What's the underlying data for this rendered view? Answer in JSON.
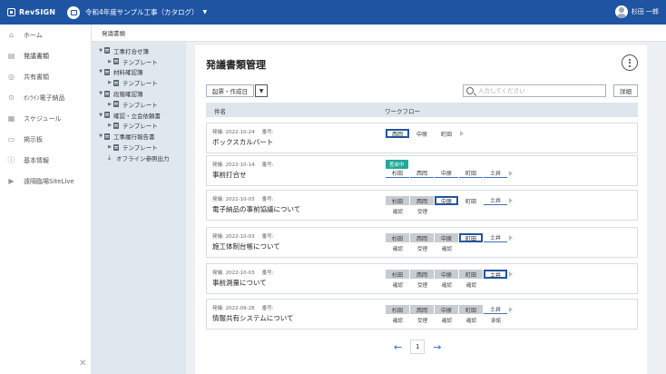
{
  "header": {
    "brand": "RevSIGN",
    "project_name": "令和4年度サンプル工事（カタログ）",
    "user_name": "杉田 一郎"
  },
  "nav": [
    {
      "label": "ホーム",
      "icon": "home-icon",
      "glyph": "⌂"
    },
    {
      "label": "発議書類",
      "icon": "document-icon",
      "glyph": "▤"
    },
    {
      "label": "共有書類",
      "icon": "share-icon",
      "glyph": "◎"
    },
    {
      "label": "ｵﾝﾗｲﾝ電子納品",
      "icon": "cloud-icon",
      "glyph": "⊙"
    },
    {
      "label": "スケジュール",
      "icon": "calendar-icon",
      "glyph": "▦"
    },
    {
      "label": "掲示板",
      "icon": "board-icon",
      "glyph": "▭"
    },
    {
      "label": "基本情報",
      "icon": "info-icon",
      "glyph": "ⓘ"
    },
    {
      "label": "遠隔臨場SiteLive",
      "icon": "video-icon",
      "glyph": "▶"
    }
  ],
  "breadcrumb": "発議書類",
  "tree": [
    {
      "label": "工事打合せ簿",
      "level": 0
    },
    {
      "label": "テンプレート",
      "level": 1
    },
    {
      "label": "材料確認簿",
      "level": 0
    },
    {
      "label": "テンプレート",
      "level": 1
    },
    {
      "label": "段階確認簿",
      "level": 0
    },
    {
      "label": "テンプレート",
      "level": 1
    },
    {
      "label": "確認・立会依頼書",
      "level": 0
    },
    {
      "label": "テンプレート",
      "level": 1
    },
    {
      "label": "工事履行報告書",
      "level": 0
    },
    {
      "label": "テンプレート",
      "level": 1
    }
  ],
  "offline_export": "オフライン参照出力",
  "main": {
    "title": "発議書類管理",
    "create_button": "起票・作成日",
    "search_placeholder": "入力してください",
    "detail_button": "詳細",
    "col_name": "件名",
    "col_workflow": "ワークフロー"
  },
  "rows": [
    {
      "date": "発議: 2022-10-24",
      "no": "番号:",
      "title": "ボックスカルバート",
      "badge": "",
      "steps": [
        {
          "label": "西岡",
          "state": "current"
        },
        {
          "label": "中原",
          "state": "pending"
        },
        {
          "label": "町田",
          "state": "pending"
        }
      ],
      "stamps": []
    },
    {
      "date": "発議: 2022-10-14",
      "no": "番号:",
      "title": "事前打合せ",
      "badge": "差戻中",
      "steps": [
        {
          "label": "杉田",
          "state": "next"
        },
        {
          "label": "西岡",
          "state": "next"
        },
        {
          "label": "中原",
          "state": "next"
        },
        {
          "label": "町田",
          "state": "next"
        },
        {
          "label": "土井",
          "state": "next"
        }
      ],
      "stamps": []
    },
    {
      "date": "発議: 2022-10-03",
      "no": "番号:",
      "title": "電子納品の事前協議について",
      "badge": "",
      "steps": [
        {
          "label": "杉田",
          "state": "done"
        },
        {
          "label": "西岡",
          "state": "done"
        },
        {
          "label": "中原",
          "state": "current"
        },
        {
          "label": "町田",
          "state": "pending"
        },
        {
          "label": "土井",
          "state": "next"
        }
      ],
      "stamps": [
        "確認",
        "受理"
      ]
    },
    {
      "date": "発議: 2022-10-03",
      "no": "番号:",
      "title": "施工体制台帳について",
      "badge": "",
      "steps": [
        {
          "label": "杉田",
          "state": "done"
        },
        {
          "label": "西岡",
          "state": "done"
        },
        {
          "label": "中原",
          "state": "done"
        },
        {
          "label": "町田",
          "state": "current"
        },
        {
          "label": "土井",
          "state": "next"
        }
      ],
      "stamps": [
        "確認",
        "受理",
        "確認"
      ]
    },
    {
      "date": "発議: 2022-10-03",
      "no": "番号:",
      "title": "事前測量について",
      "badge": "",
      "steps": [
        {
          "label": "杉田",
          "state": "done"
        },
        {
          "label": "西岡",
          "state": "done"
        },
        {
          "label": "中原",
          "state": "done"
        },
        {
          "label": "町田",
          "state": "done"
        },
        {
          "label": "土井",
          "state": "current"
        }
      ],
      "stamps": [
        "確認",
        "受理",
        "確認",
        "確認"
      ]
    },
    {
      "date": "発議: 2022-09-28",
      "no": "番号:",
      "title": "情報共有システムについて",
      "badge": "",
      "steps": [
        {
          "label": "杉田",
          "state": "done"
        },
        {
          "label": "西岡",
          "state": "done"
        },
        {
          "label": "中原",
          "state": "done"
        },
        {
          "label": "町田",
          "state": "done"
        },
        {
          "label": "土井",
          "state": "next"
        }
      ],
      "stamps": [
        "確認",
        "受理",
        "確認",
        "確認",
        "承諾"
      ]
    }
  ],
  "pager": {
    "current": "1",
    "prev": "←",
    "next": "→"
  }
}
